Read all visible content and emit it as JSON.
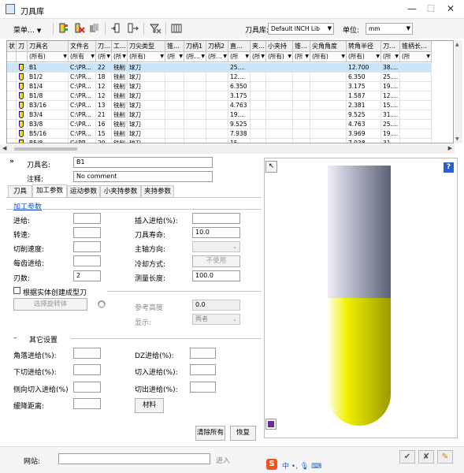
{
  "window": {
    "title": "刀具库",
    "minimize": "—",
    "maximize": "☐",
    "close": "✕"
  },
  "toolbar": {
    "menu_label": "菜单…",
    "library_label": "刀具库:",
    "library_value": "Default INCH Lib",
    "unit_label": "单位:",
    "unit_value": "mm"
  },
  "grid": {
    "columns": [
      "状",
      "刀",
      "刀具名",
      "文件名",
      "刀…",
      "工…",
      "刀尖类型",
      "锥…",
      "刀柄1",
      "刀柄2",
      "直…",
      "夹…",
      "小夹持",
      "锥…",
      "尖角角度",
      "转角半径",
      "刀…",
      "锥柄长…"
    ],
    "filters": [
      "",
      "",
      "(所有)",
      "(所有",
      "(所",
      "(所",
      "(所有)",
      "(所",
      "(所…",
      "(所…",
      "(所",
      "(所",
      "(所有)",
      "(所",
      "(所有)",
      "(所有)",
      "(所",
      "(所"
    ],
    "rows": [
      {
        "name": "B1",
        "file": "C:\\PR...",
        "num": "22",
        "type": "铣削",
        "tip": "球刀",
        "diam": "25....",
        "radius": "12.700",
        "len": "38...."
      },
      {
        "name": "B1/2",
        "file": "C:\\PR...",
        "num": "18",
        "type": "铣削",
        "tip": "球刀",
        "diam": "12....",
        "radius": "6.350",
        "len": "25...."
      },
      {
        "name": "B1/4",
        "file": "C:\\PR...",
        "num": "12",
        "type": "铣削",
        "tip": "球刀",
        "diam": "6.350",
        "radius": "3.175",
        "len": "19...."
      },
      {
        "name": "B1/8",
        "file": "C:\\PR...",
        "num": "12",
        "type": "铣削",
        "tip": "球刀",
        "diam": "3.175",
        "radius": "1.587",
        "len": "12...."
      },
      {
        "name": "B3/16",
        "file": "C:\\PR...",
        "num": "13",
        "type": "铣削",
        "tip": "球刀",
        "diam": "4.763",
        "radius": "2.381",
        "len": "15...."
      },
      {
        "name": "B3/4",
        "file": "C:\\PR...",
        "num": "21",
        "type": "铣削",
        "tip": "球刀",
        "diam": "19....",
        "radius": "9.525",
        "len": "31...."
      },
      {
        "name": "B3/8",
        "file": "C:\\PR...",
        "num": "16",
        "type": "铣削",
        "tip": "球刀",
        "diam": "9.525",
        "radius": "4.763",
        "len": "25...."
      },
      {
        "name": "B5/16",
        "file": "C:\\PR...",
        "num": "15",
        "type": "铣削",
        "tip": "球刀",
        "diam": "7.938",
        "radius": "3.969",
        "len": "19...."
      },
      {
        "name": "B5/8",
        "file": "C:\\PR...",
        "num": "20",
        "type": "铣削",
        "tip": "球刀",
        "diam": "15....",
        "radius": "7.938",
        "len": "31...."
      }
    ]
  },
  "details": {
    "tool_name_label": "刀具名:",
    "tool_name_value": "B1",
    "comment_label": "注释:",
    "comment_value": "No comment"
  },
  "tabs": [
    "刀具",
    "加工参数",
    "运动参数",
    "小夹持参数",
    "夹持参数"
  ],
  "params": {
    "section_title": "加工参数",
    "feed_label": "进给:",
    "speed_label": "转速:",
    "cut_speed_label": "切削速度:",
    "feed_per_tooth_label": "每齿进给:",
    "flutes_label": "刃数:",
    "flutes_value": "2",
    "plunge_feed_label": "插入进给(%):",
    "tool_life_label": "刀具寿命:",
    "tool_life_value": "10.0",
    "spindle_dir_label": "主轴方向:",
    "coolant_label": "冷却方式:",
    "coolant_value": "不使用",
    "gauge_length_label": "测量长度:",
    "gauge_length_value": "100.0",
    "solid_checkbox_label": "根据实体创建成型刀",
    "select_solid_button": "选择旋转体",
    "ref_height_label": "参考高度",
    "ref_height_value": "0.0",
    "display_label": "显示:",
    "display_value": "两者"
  },
  "other": {
    "section_title": "其它设置",
    "corner_feed_label": "角落进给(%):",
    "down_feed_label": "下切进给(%):",
    "lateral_feed_label": "侧向切入进给(%)",
    "retract_label": "缓降距离:",
    "dz_feed_label": "DZ进给(%):",
    "lead_in_label": "切入进给(%):",
    "lead_out_label": "切出进给(%):",
    "material_button": "材料",
    "clear_all_button": "清除所有",
    "restore_button": "恢复"
  },
  "bottom": {
    "url_label": "网站:",
    "go_button": "进入",
    "ime_text": "中 •, 🎙 ⌨"
  },
  "colors": {
    "tool_shank": "#9aa0b4",
    "tool_body": "#e8e800",
    "selection": "#cce4f7"
  }
}
